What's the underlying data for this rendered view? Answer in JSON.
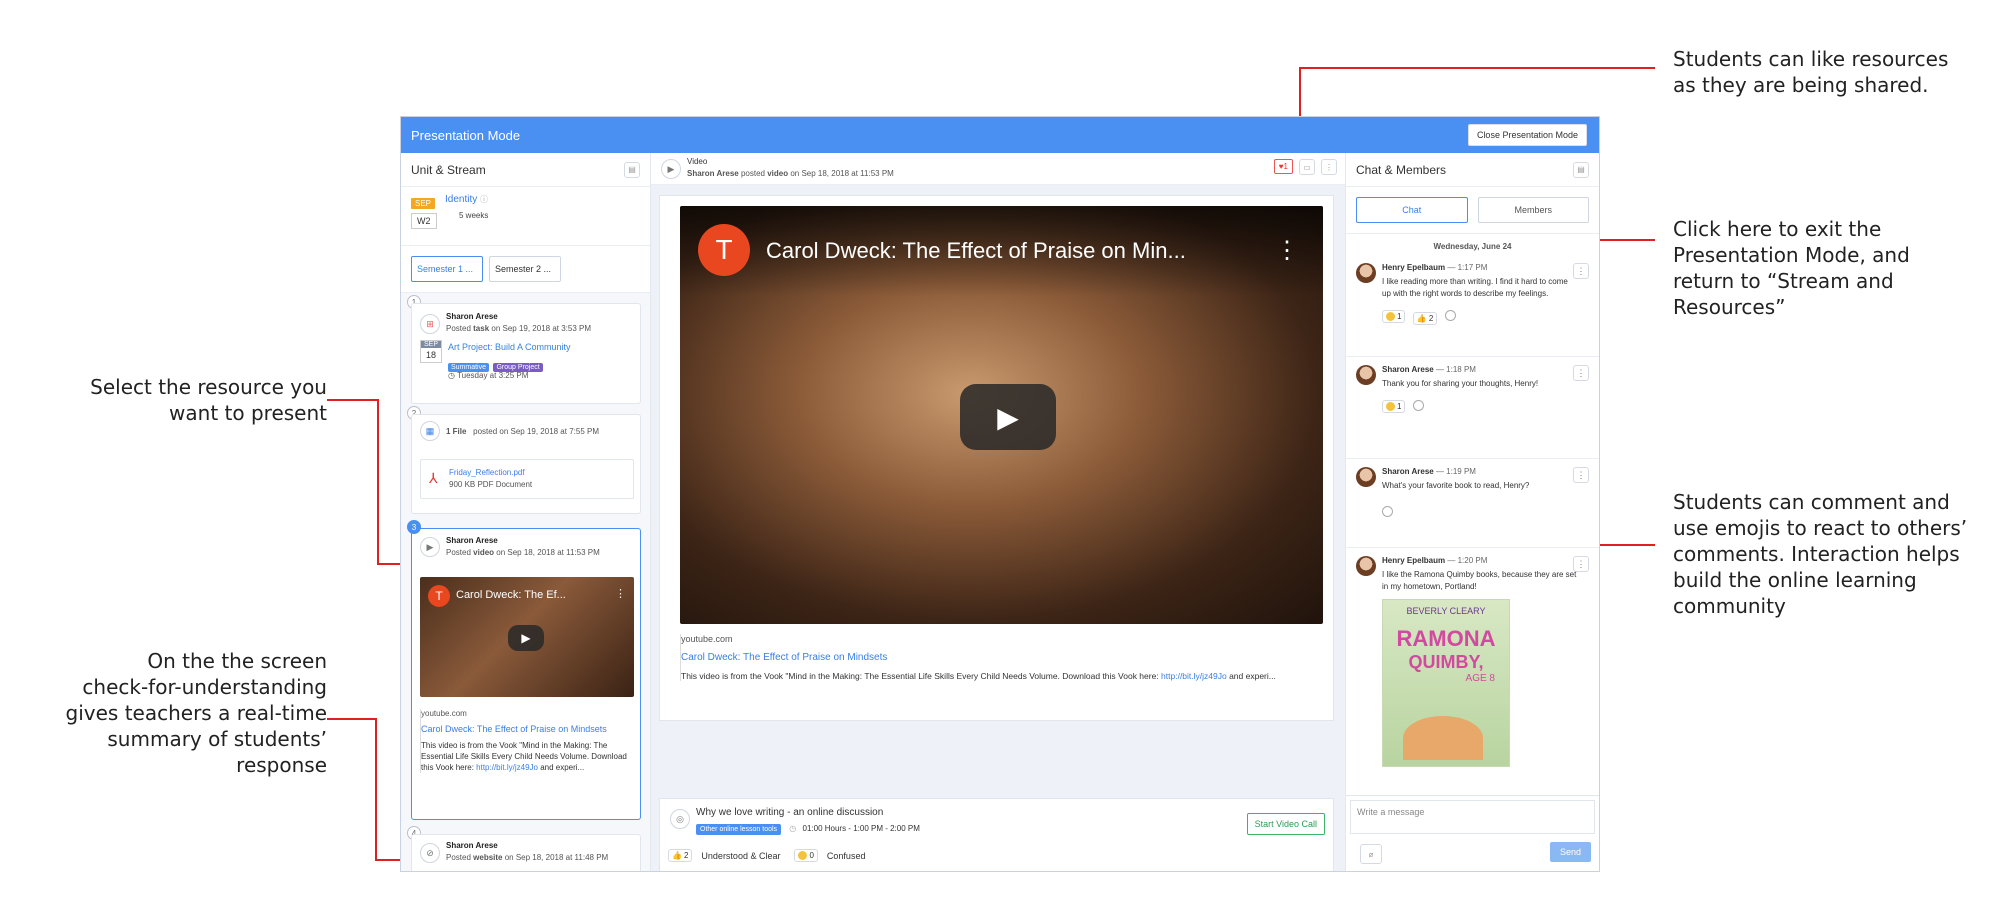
{
  "annotations": {
    "likes": [
      "Students can like resources",
      "as they are being shared."
    ],
    "exit": [
      "Click here to exit the",
      "Presentation Mode, and",
      "return to “Stream and",
      "Resources”"
    ],
    "comment": [
      "Students can comment and",
      "use emojis to react to others’",
      "comments. Interaction helps",
      "build the online learning",
      "community"
    ],
    "select": [
      "Select the resource you",
      "want to present"
    ],
    "check": [
      "On the the screen",
      "check-for-understanding",
      "gives teachers a real-time",
      "summary of students’",
      "response"
    ]
  },
  "topbar": {
    "title": "Presentation Mode",
    "close_label": "Close Presentation Mode"
  },
  "left": {
    "header": "Unit & Stream",
    "unit": {
      "month": "SEP",
      "week": "W2",
      "name": "Identity",
      "duration": "5 weeks"
    },
    "semesters": [
      "Semester 1 ...",
      "Semester 2 ..."
    ],
    "items": [
      {
        "num": "1",
        "author": "Sharon Arese",
        "meta_pre": "Posted ",
        "meta_kind": "task",
        "meta_post": " on Sep 19, 2018 at 3:53 PM",
        "due_month": "SEP",
        "due_day": "18",
        "title": "Art Project: Build A Community",
        "tags": [
          "Summative",
          "Group Project"
        ],
        "due": "Tuesday at 3:25 PM"
      },
      {
        "num": "2",
        "label": "1 File",
        "meta": "posted on Sep 19, 2018 at 7:55 PM",
        "file_name": "Friday_Reflection.pdf",
        "file_meta": "900 KB PDF Document"
      },
      {
        "num": "3",
        "author": "Sharon Arese",
        "meta_pre": "Posted ",
        "meta_kind": "video",
        "meta_post": " on Sep 18, 2018 at 11:53 PM",
        "thumb_letter": "T",
        "thumb_title": "Carol Dweck: The Ef...",
        "source": "youtube.com",
        "link": "Carol Dweck: The Effect of Praise on Mindsets",
        "desc": "This video is from the Vook \"Mind in the Making: The Essential Life Skills Every Child Needs Volume. Download this Vook here: ",
        "desc_link": "http://bit.ly/jz49Jo",
        "desc_end": " and experi..."
      },
      {
        "num": "4",
        "author": "Sharon Arese",
        "meta_pre": "Posted ",
        "meta_kind": "website",
        "meta_post": " on Sep 18, 2018 at 11:48 PM"
      }
    ]
  },
  "mid": {
    "type": "Video",
    "author": "Sharon Arese",
    "meta_mid": " posted ",
    "meta_kind": "video",
    "meta_post": " on Sep 18, 2018 at 11:53 PM",
    "likes": "1",
    "video_letter": "T",
    "video_title": "Carol Dweck: The Effect of Praise on Min...",
    "source": "youtube.com",
    "link": "Carol Dweck: The Effect of Praise on Mindsets",
    "desc": "This video is from the Vook \"Mind in the Making: The Essential Life Skills Every Child Needs Volume. Download this Vook here: ",
    "desc_link": "http://bit.ly/jz49Jo",
    "desc_end": " and experi...",
    "discussion": {
      "title": "Why we love writing - an online discussion",
      "tool_tag": "Other online lesson tools",
      "time": "01:00 Hours - 1:00 PM - 2:00 PM",
      "call_label": "Start Video Call"
    },
    "cfu": {
      "understood_count": "2",
      "understood_label": "Understood & Clear",
      "confused_count": "0",
      "confused_label": "Confused"
    }
  },
  "right": {
    "header": "Chat & Members",
    "tabs": [
      "Chat",
      "Members"
    ],
    "date": "Wednesday, June 24",
    "messages": [
      {
        "who": "Henry Epelbaum",
        "time": " — 1:17 PM",
        "text": "I like reading more than writing. I find it hard to come up with the right words to describe my feelings.",
        "r1": "1",
        "r2": "2"
      },
      {
        "who": "Sharon Arese",
        "time": " — 1:18 PM",
        "text": "Thank you for sharing your thoughts, Henry!",
        "r1": "1"
      },
      {
        "who": "Sharon Arese",
        "time": " — 1:19 PM",
        "text": "What's your favorite book to read, Henry?"
      },
      {
        "who": "Henry Epelbaum",
        "time": " — 1:20 PM",
        "text": "I like the Ramona Quimby books, because they are set in my hometown, Portland!",
        "book_author": "BEVERLY CLEARY",
        "book_title1": "RAMONA",
        "book_title2": "QUIMBY,",
        "book_sub": "AGE 8"
      }
    ],
    "compose_placeholder": "Write a message",
    "send_label": "Send"
  },
  "colors": {
    "accent": "#4a8ff2",
    "annotation_line": "#e02020",
    "sep_tag": "#f5a623",
    "summative": "#4a8ff2",
    "group": "#7a5cc4",
    "video_red": "#e8471f"
  }
}
